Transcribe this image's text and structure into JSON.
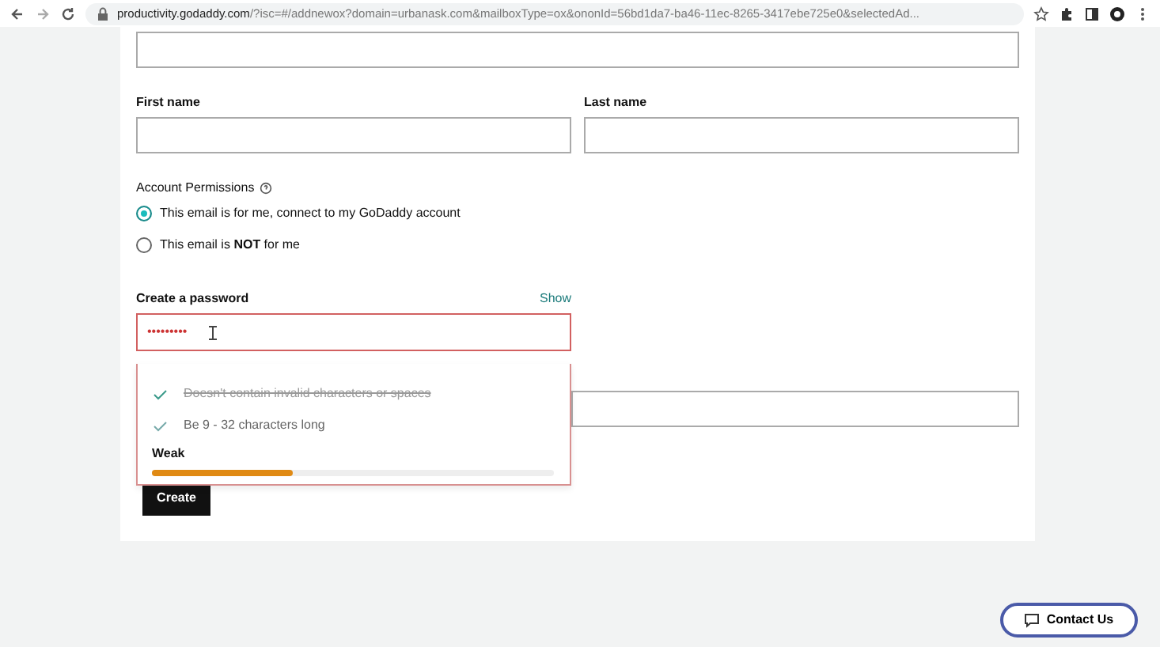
{
  "browser": {
    "url_domain": "productivity.godaddy.com",
    "url_rest": "/?isc=#/addnewox?domain=urbanask.com&mailboxType=ox&ononId=56bd1da7-ba46-11ec-8265-3417ebe725e0&selectedAd..."
  },
  "form": {
    "first_name": {
      "label": "First name"
    },
    "last_name": {
      "label": "Last name"
    },
    "permissions": {
      "label": "Account Permissions",
      "options": [
        {
          "text": "This email is for me, connect to my GoDaddy account",
          "selected": true
        },
        {
          "text": "This email is **NOT** for me",
          "selected": false
        }
      ]
    },
    "password": {
      "label": "Create a password",
      "show": "Show",
      "value": "•••••••••",
      "rules": [
        {
          "text": "Doesn't contain invalid characters or spaces",
          "met": true
        },
        {
          "text": "Be 9 - 32 characters long",
          "met": false
        }
      ],
      "strength": {
        "label": "Weak",
        "level": 0.35
      }
    },
    "submit": "Create"
  },
  "contact": "Contact Us"
}
